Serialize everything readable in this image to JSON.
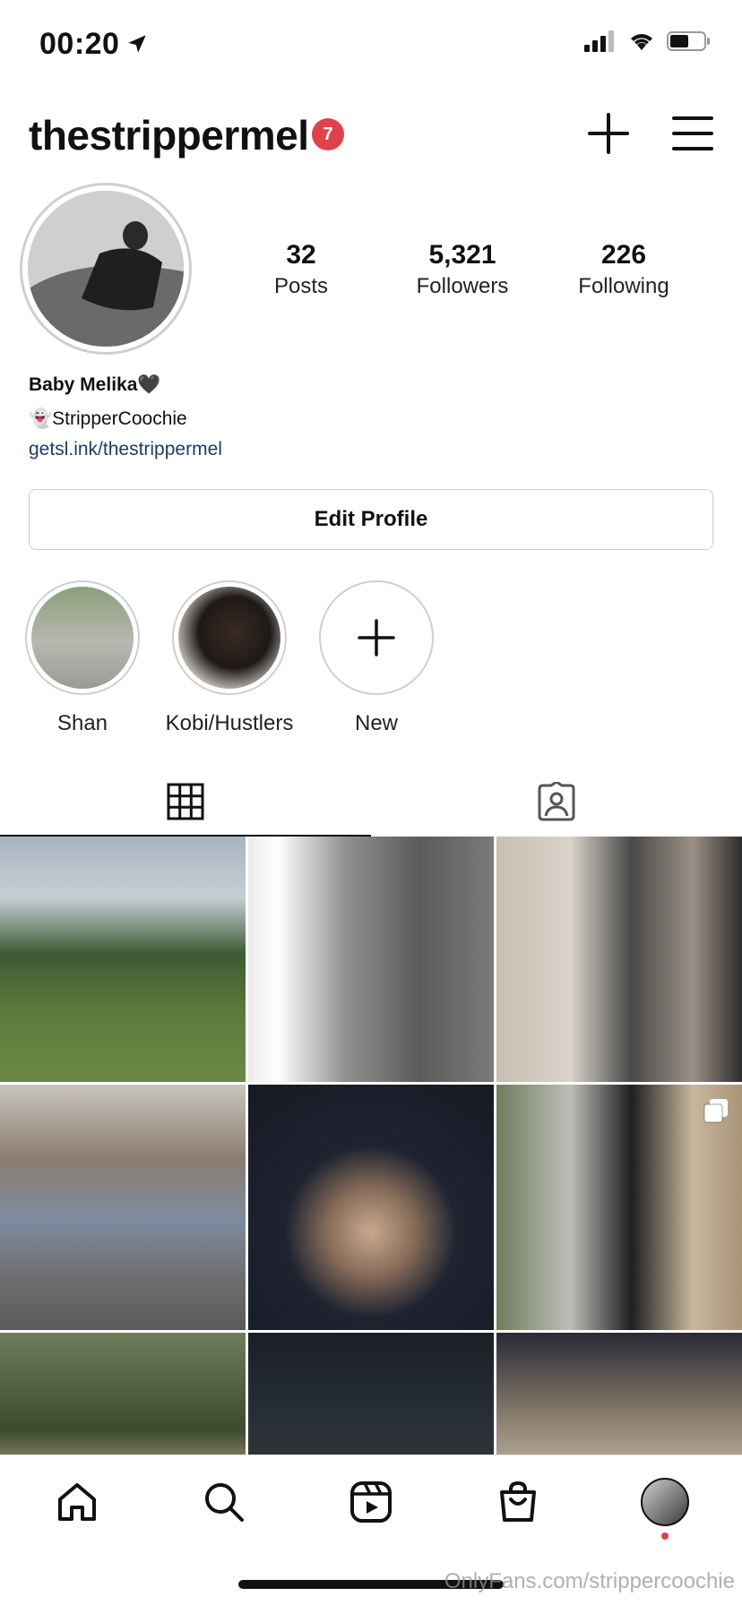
{
  "status_bar": {
    "time": "00:20"
  },
  "header": {
    "username": "thestrippermel",
    "notification_count": "7"
  },
  "profile": {
    "stats": [
      {
        "value": "32",
        "label": "Posts"
      },
      {
        "value": "5,321",
        "label": "Followers"
      },
      {
        "value": "226",
        "label": "Following"
      }
    ],
    "name": "Baby Melika🖤",
    "bio_line": "👻StripperCoochie",
    "link": "getsl.ink/thestrippermel",
    "edit_button": "Edit Profile"
  },
  "highlights": [
    {
      "label": "Shan"
    },
    {
      "label": "Kobi/Hustlers"
    },
    {
      "label": "New"
    }
  ],
  "tabs": [
    {
      "icon": "grid-icon",
      "active": true
    },
    {
      "icon": "tagged-icon",
      "active": false
    }
  ],
  "bottom_nav": [
    {
      "icon": "home-icon"
    },
    {
      "icon": "search-icon"
    },
    {
      "icon": "reels-icon"
    },
    {
      "icon": "shop-icon"
    },
    {
      "icon": "profile-avatar"
    }
  ],
  "watermark": "OnlyFans.com/strippercoochie",
  "colors": {
    "badge": "#e0424c",
    "link": "#1e3a5f",
    "active_tab": "#111111"
  }
}
